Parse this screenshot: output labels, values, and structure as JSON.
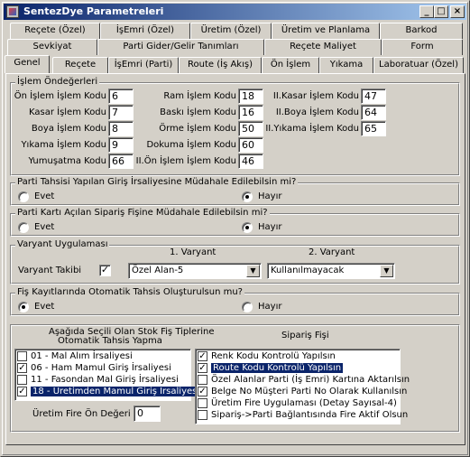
{
  "window": {
    "title": "SentezDye Parametreleri"
  },
  "tabs": {
    "row1": [
      "Reçete (Özel)",
      "İşEmri (Özel)",
      "Üretim (Özel)",
      "Üretim ve Planlama",
      "Barkod"
    ],
    "row2": [
      "Sevkiyat",
      "Parti Gider/Gelir Tanımları",
      "Reçete Maliyet",
      "Form"
    ],
    "row3": [
      "Genel",
      "Reçete",
      "İşEmri (Parti)",
      "Route (İş Akış)",
      "Ön İşlem",
      "Yıkama",
      "Laboratuar (Özel)"
    ],
    "active": "Genel"
  },
  "islem_ondegerleri": {
    "title": "İşlem Öndeğerleri",
    "col1": [
      {
        "label": "Ön İşlem İşlem Kodu",
        "value": "6"
      },
      {
        "label": "Kasar İşlem Kodu",
        "value": "7"
      },
      {
        "label": "Boya İşlem Kodu",
        "value": "8"
      },
      {
        "label": "Yıkama İşlem Kodu",
        "value": "9"
      },
      {
        "label": "Yumuşatma Kodu",
        "value": "66"
      }
    ],
    "col2": [
      {
        "label": "Ram İşlem Kodu",
        "value": "18"
      },
      {
        "label": "Baskı İşlem Kodu",
        "value": "16"
      },
      {
        "label": "Örme İşlem Kodu",
        "value": "50"
      },
      {
        "label": "Dokuma İşlem Kodu",
        "value": "60"
      },
      {
        "label": "II.Ön İşlem İşlem Kodu",
        "value": "46"
      }
    ],
    "col3": [
      {
        "label": "II.Kasar İşlem Kodu",
        "value": "47"
      },
      {
        "label": "II.Boya İşlem Kodu",
        "value": "64"
      },
      {
        "label": "II.Yıkama İşlem Kodu",
        "value": "65"
      }
    ]
  },
  "parti_tahsisi": {
    "title": "Parti Tahsisi Yapılan Giriş İrsaliyesine Müdahale Edilebilsin mi?",
    "yes": "Evet",
    "no": "Hayır",
    "selected": "no"
  },
  "parti_karti": {
    "title": "Parti Kartı Açılan Sipariş Fişine Müdahale Edilebilsin mi?",
    "yes": "Evet",
    "no": "Hayır",
    "selected": "no"
  },
  "varyant": {
    "title": "Varyant Uygulaması",
    "col1_header": "1. Varyant",
    "col2_header": "2. Varyant",
    "takibi_label": "Varyant Takibi",
    "takibi_checked": true,
    "v1_value": "Özel Alan-5",
    "v2_value": "Kullanılmayacak"
  },
  "fis_kayit": {
    "title": "Fiş Kayıtlarında Otomatik Tahsis Oluşturulsun mu?",
    "yes": "Evet",
    "no": "Hayır",
    "selected": "yes"
  },
  "stok_fis": {
    "title_line1": "Aşağıda Seçili Olan Stok Fiş Tiplerine",
    "title_line2": "Otomatik Tahsis Yapma",
    "items": [
      {
        "label": "01 - Mal Alım İrsaliyesi",
        "checked": false
      },
      {
        "label": "06 - Ham Mamul Giriş İrsaliyesi",
        "checked": true
      },
      {
        "label": "11 - Fasondan Mal Giriş İrsaliyesi",
        "checked": false
      },
      {
        "label": "18 - Üretimden Mamul Giriş İrsaliyesi",
        "checked": true
      }
    ],
    "selected_index": 3,
    "fire_label": "Üretim Fire Ön Değeri",
    "fire_value": "0"
  },
  "siparis_fisi": {
    "title": "Sipariş Fişi",
    "items": [
      {
        "label": "Renk Kodu Kontrolü Yapılsın",
        "checked": true
      },
      {
        "label": "Route Kodu Kontrolü Yapılsın",
        "checked": true
      },
      {
        "label": "Özel Alanlar Parti (İş Emri) Kartına Aktarılsın",
        "checked": false
      },
      {
        "label": "Belge No Müşteri Parti No Olarak Kullanılsın",
        "checked": true
      },
      {
        "label": "Üretim Fire Uygulaması (Detay Sayısal-4)",
        "checked": false
      },
      {
        "label": "Sipariş->Parti Bağlantısında Fire Aktif Olsun",
        "checked": false
      }
    ],
    "selected_index": 1
  },
  "colors": {
    "face": "#d4d0c8",
    "title_start": "#0a246a",
    "title_end": "#a6caf0",
    "selection": "#0a246a"
  }
}
